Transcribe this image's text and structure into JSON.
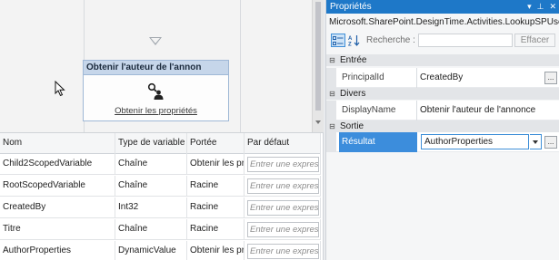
{
  "designer": {
    "activity_title": "Obtenir l'auteur de l'annon",
    "activity_link": "Obtenir les propriétés"
  },
  "variables": {
    "columns": [
      "Nom",
      "Type de variable",
      "Portée",
      "Par défaut"
    ],
    "placeholder": "Entrer une express",
    "rows": [
      {
        "name": "Child2ScopedVariable",
        "type": "Chaîne",
        "scope": "Obtenir les pr"
      },
      {
        "name": "RootScopedVariable",
        "type": "Chaîne",
        "scope": "Racine"
      },
      {
        "name": "CreatedBy",
        "type": "Int32",
        "scope": "Racine"
      },
      {
        "name": "Titre",
        "type": "Chaîne",
        "scope": "Racine"
      },
      {
        "name": "AuthorProperties",
        "type": "DynamicValue",
        "scope": "Obtenir les pr"
      }
    ]
  },
  "properties": {
    "title": "Propriétés",
    "controls": [
      "▾",
      "⊥",
      "✕"
    ],
    "type_name": "Microsoft.SharePoint.DesignTime.Activities.LookupSPUser",
    "search_label": "Recherche :",
    "clear_label": "Effacer",
    "categories": {
      "entree": "Entrée",
      "divers": "Divers",
      "sortie": "Sortie"
    },
    "rows": {
      "principal": {
        "name": "PrincipalId",
        "value": "CreatedBy"
      },
      "display": {
        "name": "DisplayName",
        "value": "Obtenir l'auteur de l'annonce"
      },
      "result": {
        "name": "Résultat",
        "value": "AuthorProperties"
      }
    },
    "ellipsis": "..."
  }
}
